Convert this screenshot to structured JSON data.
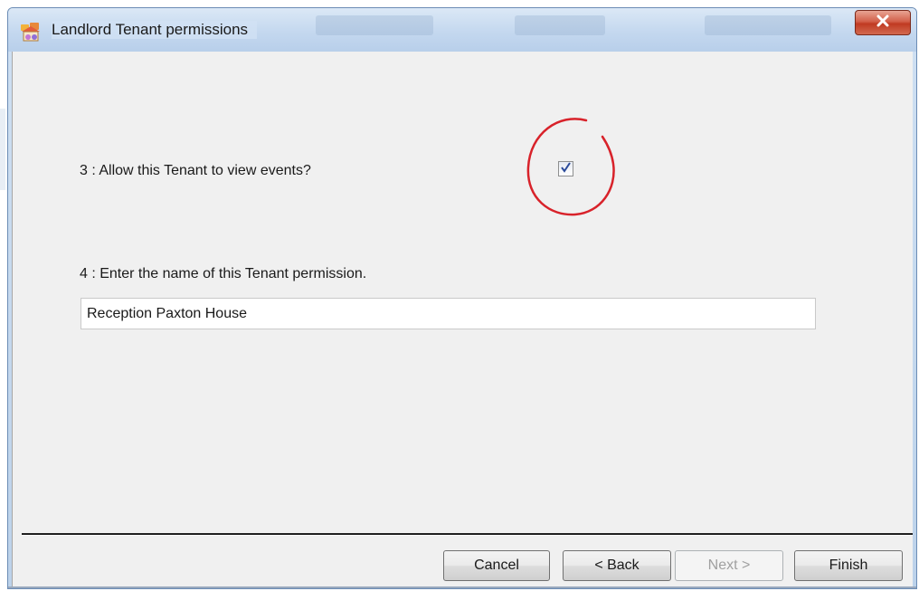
{
  "window": {
    "title": "Landlord Tenant permissions",
    "icon": "landlord-app-icon",
    "close_icon": "close-x-icon",
    "close_label": "X"
  },
  "form": {
    "question3_label": "3 : Allow this Tenant to view events?",
    "question3_checked": true,
    "question4_label": "4 : Enter the name of this Tenant permission.",
    "permission_name_value": "Reception Paxton House",
    "permission_name_placeholder": ""
  },
  "annotation": {
    "highlight_color": "#d8222a"
  },
  "buttons": {
    "cancel_label": "Cancel",
    "back_label": "< Back",
    "next_label": "Next >",
    "next_disabled": true,
    "finish_label": "Finish"
  },
  "colors": {
    "dialog_background": "#f0f0f0",
    "titlebar": "#c4d8ef",
    "close_button": "#c8452d",
    "checkmark": "#2a4a9a"
  }
}
